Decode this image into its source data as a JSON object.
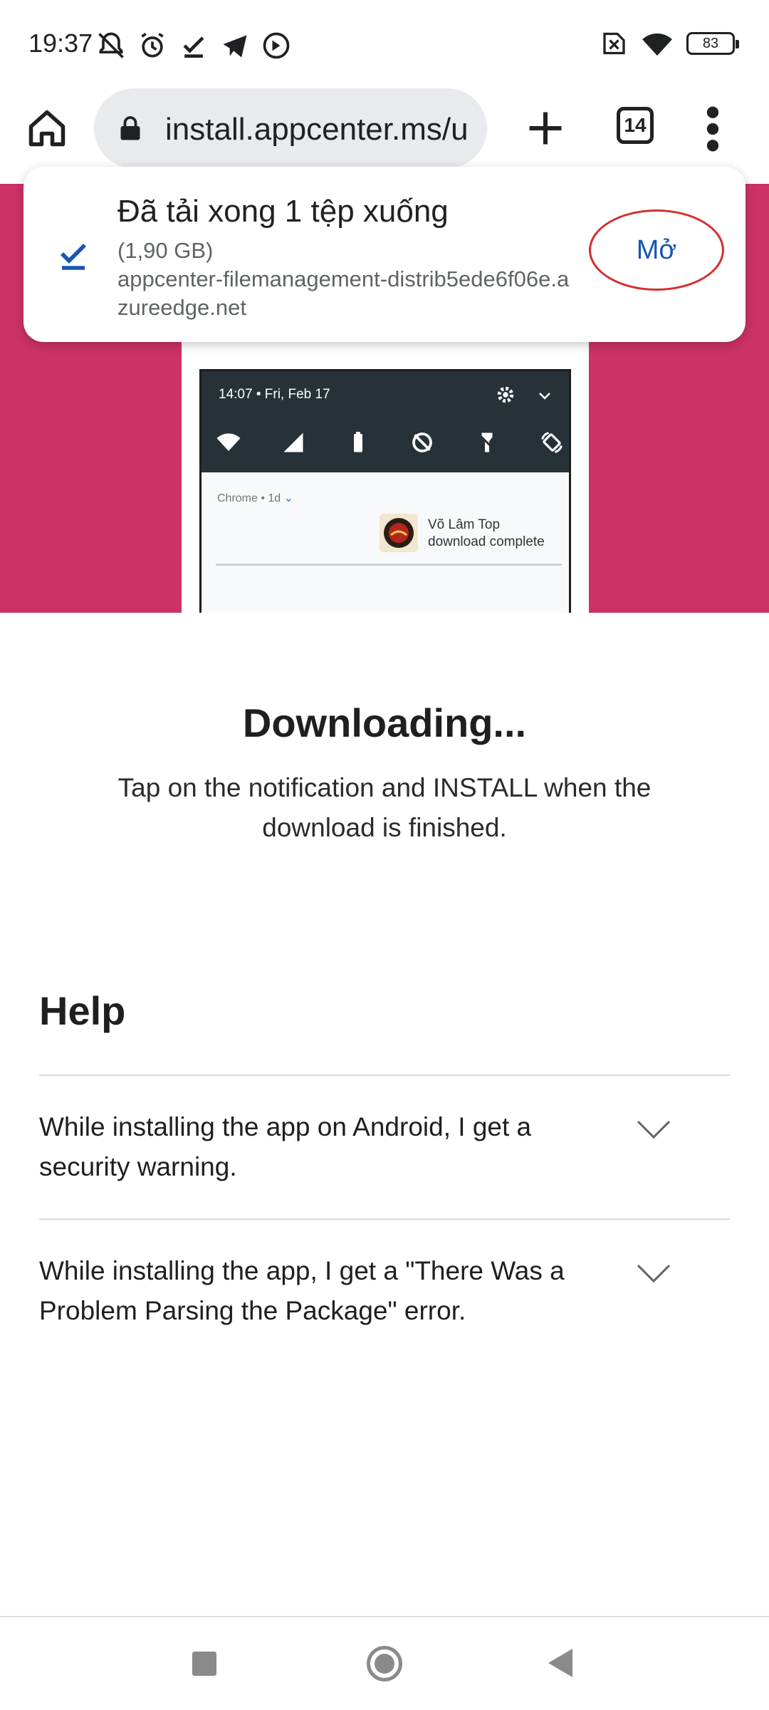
{
  "status_bar": {
    "time": "19:37",
    "left_icons": [
      "muted-bell-icon",
      "alarm-icon",
      "check-icon",
      "telegram-icon",
      "data-saver-icon"
    ],
    "right_icons": [
      "no-sim-icon",
      "wifi-icon"
    ],
    "battery": "83"
  },
  "toolbar": {
    "url": "install.appcenter.ms/u",
    "tab_count": "14"
  },
  "download_popup": {
    "title": "Đã tải xong 1 tệp xuống",
    "size": "(1,90 GB)",
    "source": "appcenter-filemanagement-distrib5ede6f06e.azureedge.net",
    "open_label": "Mở"
  },
  "preview": {
    "time": "14:07 • Fri, Feb 17",
    "meta_app": "Chrome • 1d",
    "meta_dropdown": "⌄",
    "notif_title": "Võ Lâm Top",
    "notif_body": "download complete"
  },
  "main": {
    "heading": "Downloading...",
    "instructions": "Tap on the notification and INSTALL when the download is finished."
  },
  "help": {
    "title": "Help",
    "items": [
      {
        "question": "While installing the app on Android, I get a security warning."
      },
      {
        "question": "While installing the app, I get a \"There Was a Problem Parsing the Package\" error."
      }
    ]
  },
  "colors": {
    "hero": "#cc3266",
    "accent": "#1a56b0",
    "highlight_circle": "#d32f2f"
  }
}
